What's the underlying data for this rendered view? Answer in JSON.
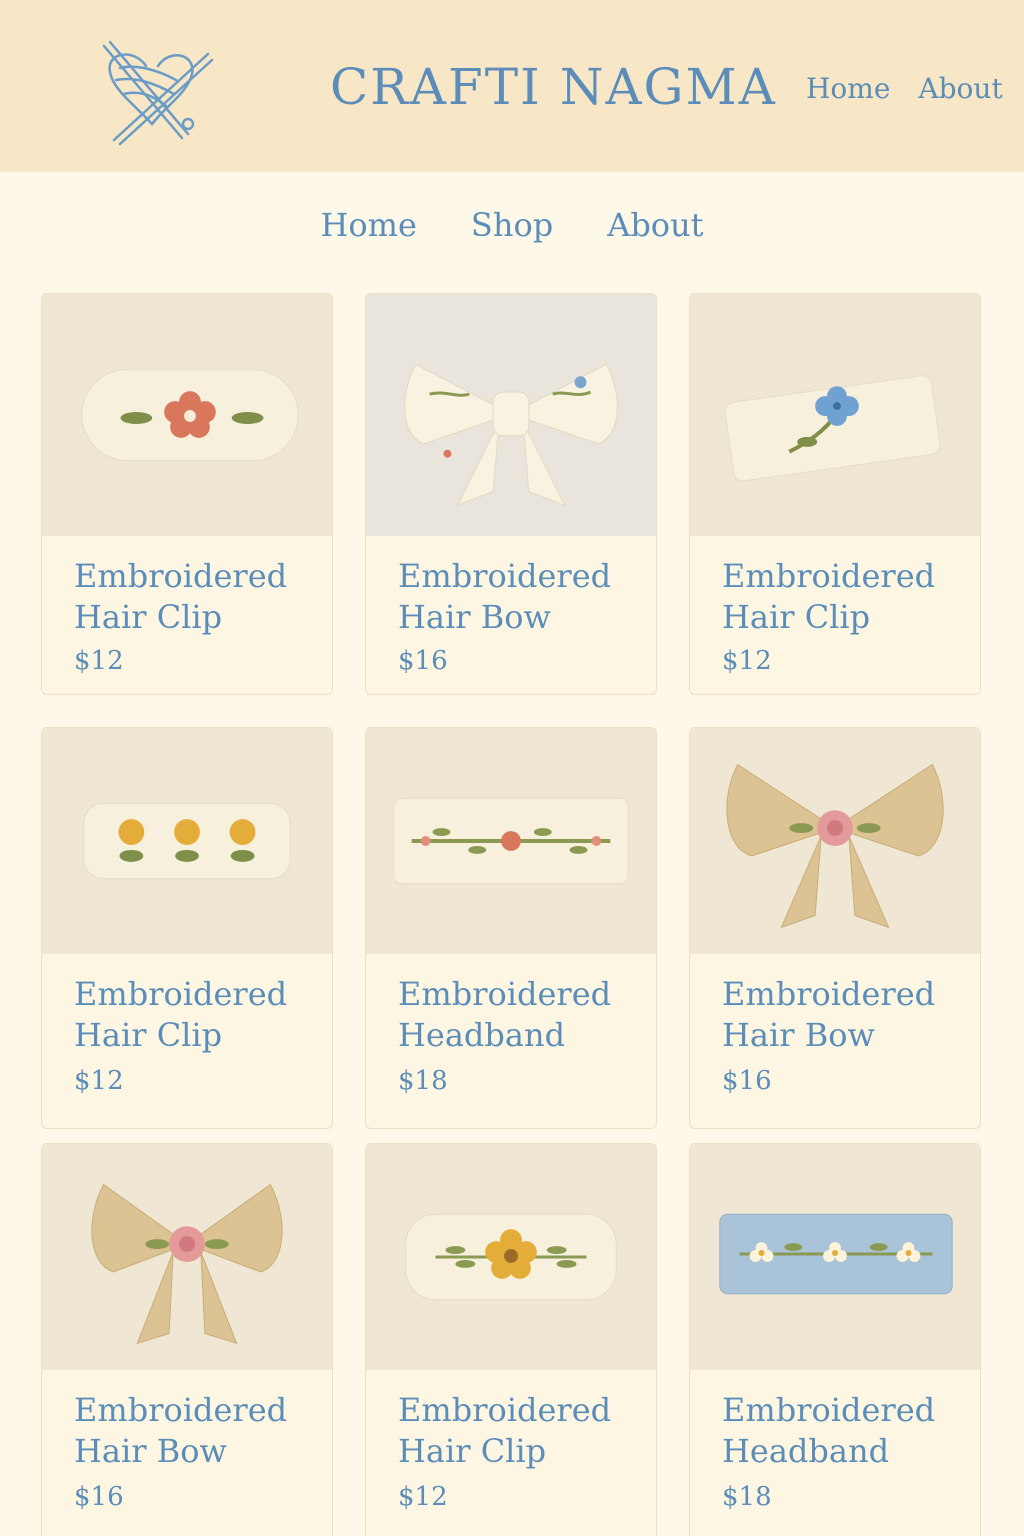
{
  "header": {
    "brand": "CRAFTI NAGMA",
    "top_nav": [
      "Home",
      "About"
    ]
  },
  "main_nav": [
    "Home",
    "Shop",
    "About"
  ],
  "products": [
    {
      "name": "Embroidered Hair Clip",
      "price": "$12"
    },
    {
      "name": "Embroidered Hair Bow",
      "price": "$16"
    },
    {
      "name": "Embroidered Hair Clip",
      "price": "$12"
    },
    {
      "name": "Embroidered Hair Clip",
      "price": "$12"
    },
    {
      "name": "Embroidered Headband",
      "price": "$18"
    },
    {
      "name": "Embroidered Hair Bow",
      "price": "$16"
    },
    {
      "name": "Embroidered Hair Bow",
      "price": "$16"
    },
    {
      "name": "Embroidered Hair Clip",
      "price": "$12"
    },
    {
      "name": "Embroidered Headband",
      "price": "$18"
    }
  ],
  "colors": {
    "header_bg": "#f8e7c6",
    "page_bg": "#fdf8e8",
    "accent_blue": "#5b8db8",
    "card_image_bg": "#efe7d3"
  }
}
